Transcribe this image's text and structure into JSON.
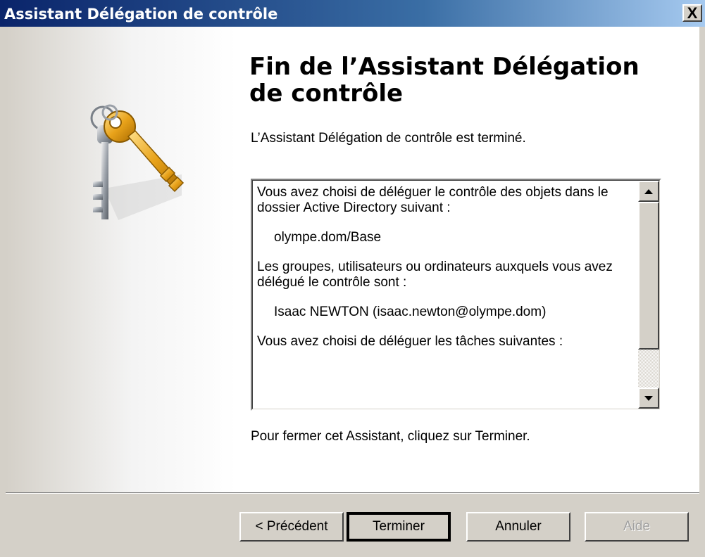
{
  "window": {
    "title": "Assistant Délégation de contrôle",
    "close_label": "X"
  },
  "content": {
    "heading": "Fin de l’Assistant Délégation de contrôle",
    "intro": "L’Assistant Délégation de contrôle est terminé.",
    "summary": {
      "line1": "Vous avez choisi de déléguer le contrôle des objets dans le dossier Active Directory suivant :",
      "folder": "olympe.dom/Base",
      "line2": "Les groupes, utilisateurs ou ordinateurs auxquels vous avez délégué le contrôle sont :",
      "user": "Isaac NEWTON (isaac.newton@olympe.dom)",
      "line3": "Vous avez choisi de déléguer les tâches suivantes :"
    },
    "closing": "Pour fermer cet Assistant, cliquez sur Terminer."
  },
  "buttons": {
    "previous": "< Précédent",
    "finish": "Terminer",
    "cancel": "Annuler",
    "help": "Aide"
  },
  "icons": {
    "keys": "keys-icon"
  }
}
